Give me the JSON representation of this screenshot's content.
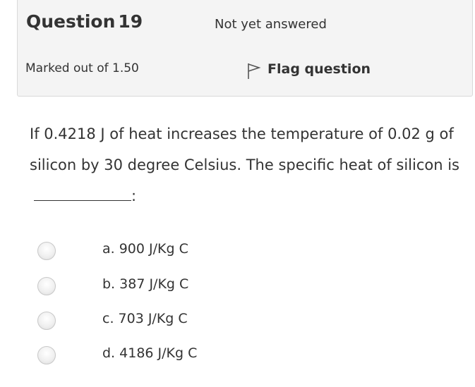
{
  "info": {
    "question_label": "Question",
    "question_number": "19",
    "state": "Not yet answered",
    "grade": "Marked out of 1.50",
    "flag_label": "Flag question",
    "flag_icon": "flag-icon"
  },
  "question": {
    "text_before_blank": "If 0.4218 J of heat increases the temperature of 0.02 g of silicon by 30 degree Celsius. The specific heat of silicon is",
    "text_after_blank": ":"
  },
  "answers": [
    {
      "label": "a. 900 J/Kg C",
      "selected": false
    },
    {
      "label": "b. 387 J/Kg C",
      "selected": false
    },
    {
      "label": "c. 703 J/Kg C",
      "selected": false
    },
    {
      "label": "d. 4186 J/Kg C",
      "selected": false
    }
  ]
}
